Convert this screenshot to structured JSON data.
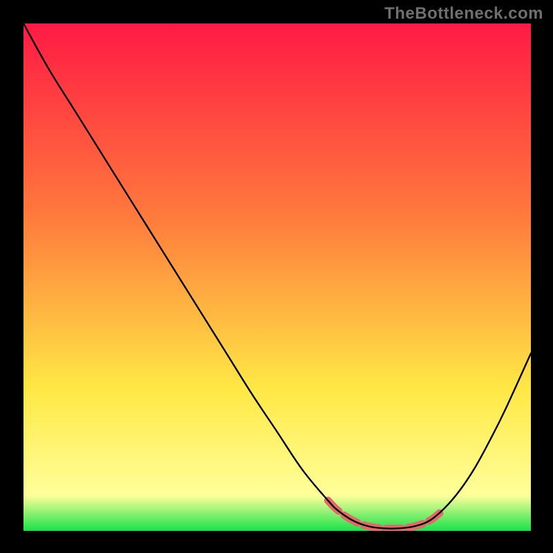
{
  "watermark": "TheBottleneck.com",
  "chart_data": {
    "type": "line",
    "title": "",
    "xlabel": "",
    "ylabel": "",
    "xlim": [
      0,
      100
    ],
    "ylim": [
      0,
      100
    ],
    "background_gradient": {
      "top": "#ff1a44",
      "mid1": "#ff7a3c",
      "mid2": "#ffe845",
      "low": "#ffff9a",
      "bottom": "#18e24a"
    },
    "series": [
      {
        "name": "bottleneck-curve",
        "stroke": "#000000",
        "x": [
          0,
          5,
          10,
          15,
          20,
          25,
          30,
          35,
          40,
          45,
          50,
          55,
          60,
          62,
          65,
          68,
          71,
          74,
          77,
          80,
          83,
          86,
          89,
          92,
          95,
          100
        ],
        "values": [
          100,
          91,
          83,
          75,
          67,
          59,
          51,
          43,
          35,
          27,
          19.5,
          12,
          6,
          4,
          2,
          0.9,
          0.5,
          0.5,
          0.9,
          2,
          4.5,
          8,
          12.5,
          18,
          24,
          35
        ]
      },
      {
        "name": "trough-highlight",
        "stroke": "#e46a6a",
        "stroke_width_factor": 5,
        "x": [
          60,
          62,
          65,
          68,
          71,
          74,
          77,
          80,
          82
        ],
        "values": [
          6,
          4,
          2,
          0.9,
          0.5,
          0.5,
          0.9,
          2,
          3.5
        ]
      }
    ]
  }
}
